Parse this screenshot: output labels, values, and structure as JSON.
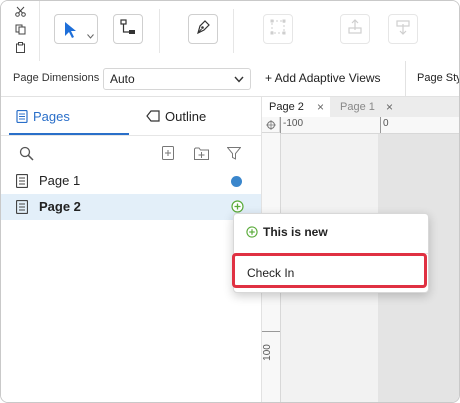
{
  "toolbar": {
    "edit_icons": [
      "scissors-icon",
      "copy-icon",
      "paste-icon"
    ],
    "tools": [
      "select-pointer-icon",
      "flow-connector-icon",
      "pen-icon",
      "group-icon",
      "bring-forward-icon",
      "send-backward-icon"
    ]
  },
  "properties": {
    "page_dimensions_label": "Page Dimensions",
    "page_dimensions_value": "Auto",
    "add_adaptive_views": "+ Add Adaptive Views",
    "page_style_label": "Page Sty"
  },
  "left_panel": {
    "tabs": [
      {
        "label": "Pages",
        "active": true
      },
      {
        "label": "Outline",
        "active": false
      }
    ],
    "pages": [
      {
        "label": "Page 1",
        "status": "blue-dot"
      },
      {
        "label": "Page 2",
        "status": "new",
        "selected": true
      }
    ]
  },
  "canvas": {
    "doc_tabs": [
      {
        "label": "Page 2",
        "close": "×",
        "active": true
      },
      {
        "label": "Page 1",
        "close": "×",
        "active": false
      }
    ],
    "ruler_top": {
      "tick1": "-100",
      "tick2": "0"
    },
    "ruler_left": {
      "tick1": "100"
    }
  },
  "popup": {
    "header": "This is new",
    "item": "Check In"
  },
  "colors": {
    "accent": "#2a6fc9",
    "status_dot": "#3a86cc",
    "new_badge": "#5aab3a",
    "highlight": "#e03142",
    "selected_row": "#e3eff9"
  }
}
